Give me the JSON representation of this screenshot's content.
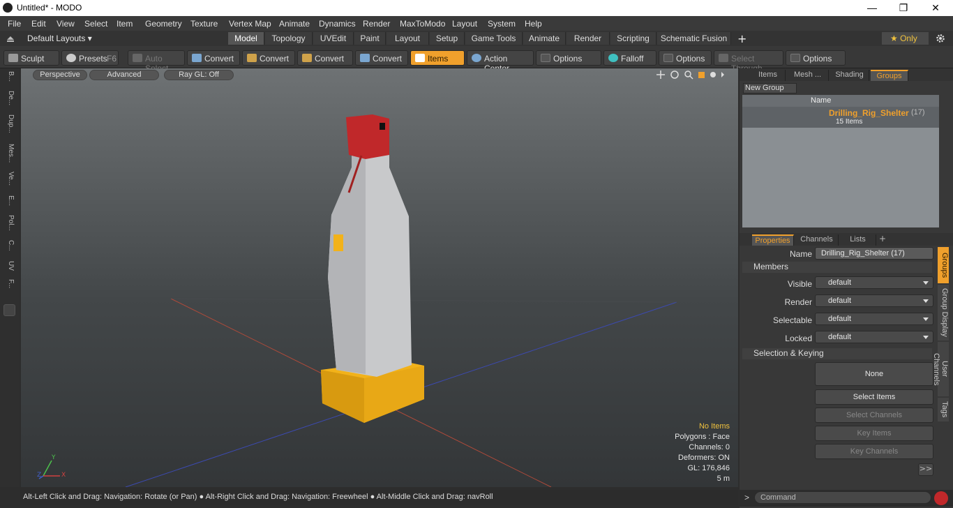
{
  "window": {
    "title": "Untitled* - MODO",
    "minimize": "—",
    "restore": "❐",
    "close": "✕"
  },
  "menu": [
    "File",
    "Edit",
    "View",
    "Select",
    "Item",
    "Geometry",
    "Texture",
    "Vertex Map",
    "Animate",
    "Dynamics",
    "Render",
    "MaxToModo",
    "Layout",
    "System",
    "Help"
  ],
  "layoutbar": {
    "layout_label": "Default Layouts ▾",
    "tabs": [
      "Model",
      "Topology",
      "UVEdit",
      "Paint",
      "Layout",
      "Setup",
      "Game Tools",
      "Animate",
      "Render",
      "Scripting",
      "Schematic Fusion"
    ],
    "active_tab": "Model",
    "add": "+",
    "only": "★  Only"
  },
  "toolbar": {
    "sculpt": "Sculpt",
    "presets": "Presets",
    "presets_key": "F6",
    "auto_select": "Auto Select",
    "convert1": "Convert",
    "convert2": "Convert",
    "convert3": "Convert",
    "convert4": "Convert",
    "items": "Items",
    "action_center": "Action Center",
    "options1": "Options",
    "falloff": "Falloff",
    "options2": "Options",
    "select_through": "Select Through",
    "options3": "Options"
  },
  "lefttabs": [
    "B...",
    "De...",
    "Dup...",
    "Mes...",
    "Ve...",
    "E...",
    "Pol...",
    "C...",
    "UV",
    "F..."
  ],
  "viewport": {
    "perspective": "Perspective",
    "advanced": "Advanced",
    "raygl": "Ray GL: Off",
    "no_items": "No Items",
    "polygons": "Polygons : Face",
    "channels": "Channels: 0",
    "deformers": "Deformers: ON",
    "gl": "GL: 176,846",
    "scale": "5 m",
    "axis_x": "X",
    "axis_y": "Y",
    "axis_z": "Z"
  },
  "status": {
    "text": "Alt-Left Click and Drag: Navigation: Rotate (or Pan) ● Alt-Right Click and Drag: Navigation: Freewheel ● Alt-Middle Click and Drag: navRoll"
  },
  "groups_panel": {
    "tabs": [
      "Items",
      "Mesh ...",
      "Shading",
      "Groups"
    ],
    "active_tab": "Groups",
    "new_group": "New Group",
    "col_name": "Name",
    "group_name": "Drilling_Rig_Shelter",
    "group_count": "(17)",
    "group_items": "15 Items"
  },
  "properties": {
    "tabs": [
      "Properties",
      "Channels",
      "Lists"
    ],
    "add": "+",
    "name_label": "Name",
    "name_value": "Drilling_Rig_Shelter (17)",
    "members_section": "Members",
    "visible_label": "Visible",
    "visible_value": "default",
    "render_label": "Render",
    "render_value": "default",
    "selectable_label": "Selectable",
    "selectable_value": "default",
    "locked_label": "Locked",
    "locked_value": "default",
    "selkey_section": "Selection & Keying",
    "none_button": "None",
    "select_items": "Select Items",
    "select_channels": "Select Channels",
    "key_items": "Key Items",
    "key_channels": "Key Channels",
    "more": ">>",
    "side_tabs": [
      "Groups",
      "Group Display",
      "User Channels",
      "Tags"
    ]
  },
  "command": {
    "arrow": ">",
    "placeholder": "Command"
  },
  "colors": {
    "accent": "#f0a02c",
    "tower_red": "#c0282a",
    "base_yellow": "#f2b21a"
  }
}
